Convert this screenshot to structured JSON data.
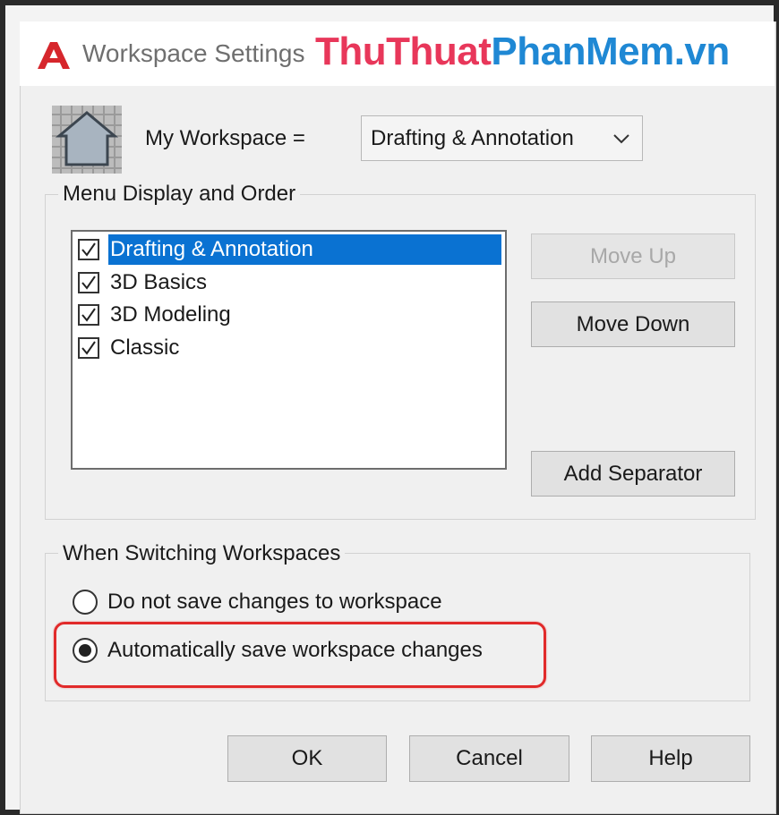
{
  "window": {
    "title": "Workspace Settings"
  },
  "watermark": {
    "part1": "ThuThuat",
    "part2": "PhanMem.vn",
    "color1": "#e8375a",
    "color2": "#1f88d4"
  },
  "workspace": {
    "label": "My Workspace =",
    "selected": "Drafting & Annotation"
  },
  "menu_group": {
    "title": "Menu Display and Order",
    "items": [
      {
        "label": "Drafting & Annotation",
        "checked": true,
        "selected": true
      },
      {
        "label": "3D Basics",
        "checked": true,
        "selected": false
      },
      {
        "label": "3D Modeling",
        "checked": true,
        "selected": false
      },
      {
        "label": "Classic",
        "checked": true,
        "selected": false
      }
    ],
    "move_up": "Move Up",
    "move_down": "Move Down",
    "add_separator": "Add Separator"
  },
  "switch_group": {
    "title": "When Switching Workspaces",
    "options": [
      {
        "label": "Do not save changes to workspace",
        "selected": false
      },
      {
        "label": "Automatically save workspace changes",
        "selected": true
      }
    ]
  },
  "footer": {
    "ok": "OK",
    "cancel": "Cancel",
    "help": "Help"
  },
  "colors": {
    "selection": "#0a72d2",
    "highlight_box": "#e12a2a",
    "app_logo": "#d6262c"
  }
}
